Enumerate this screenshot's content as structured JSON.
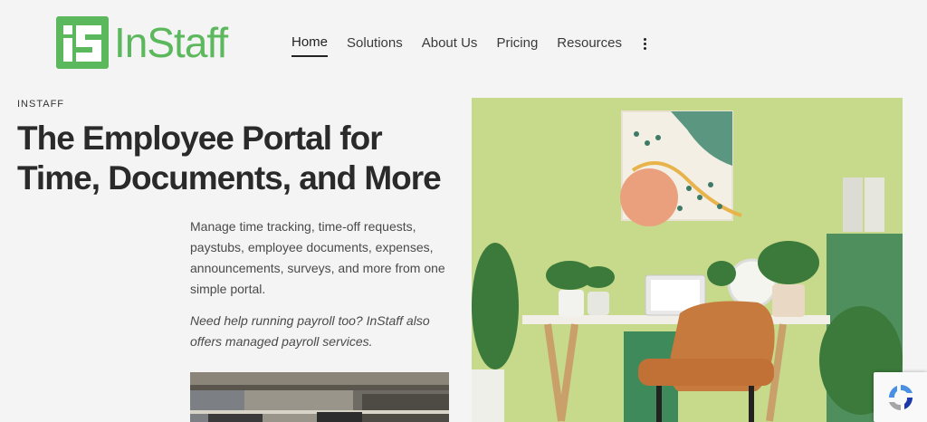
{
  "brand": {
    "name": "InStaff",
    "color": "#5cb85c"
  },
  "nav": {
    "items": [
      {
        "label": "Home",
        "active": true
      },
      {
        "label": "Solutions",
        "active": false
      },
      {
        "label": "About Us",
        "active": false
      },
      {
        "label": "Pricing",
        "active": false
      },
      {
        "label": "Resources",
        "active": false
      }
    ],
    "more_icon": "vertical-ellipsis-icon"
  },
  "hero": {
    "eyebrow": "INSTAFF",
    "title_line1": "The Employee Portal for",
    "title_line2": "Time, Documents, and More",
    "description": "Manage time tracking, time-off requests, paystubs, employee documents, expenses, announcements, surveys, and more from one simple portal.",
    "note": "Need help running payroll too? InStaff also offers managed payroll services."
  },
  "widgets": {
    "recaptcha_icon": "recaptcha-icon"
  }
}
